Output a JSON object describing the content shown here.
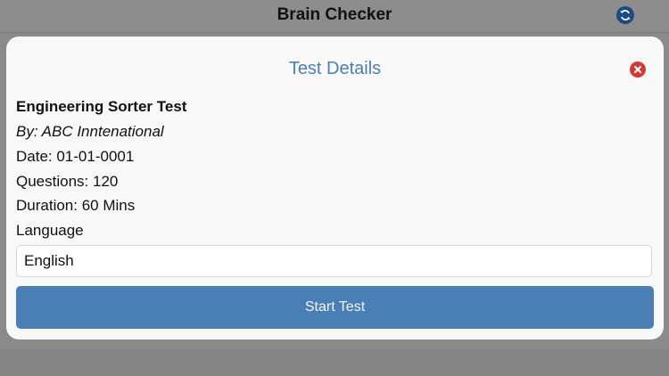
{
  "app": {
    "title": "Brain Checker",
    "refresh_icon": "refresh-icon"
  },
  "modal": {
    "title": "Test Details",
    "close_icon": "close-icon",
    "test_name": "Engineering Sorter Test",
    "author": "By: ABC Inntenational",
    "date": "Date: 01-01-0001",
    "questions": "Questions: 120",
    "duration": "Duration: 60 Mins",
    "language_label": "Language",
    "language_value": "English",
    "start_button": "Start Test"
  },
  "colors": {
    "accent": "#4a7fb5",
    "title": "#4a80b4",
    "close": "#d23b3b",
    "refresh": "#1c4a86"
  }
}
